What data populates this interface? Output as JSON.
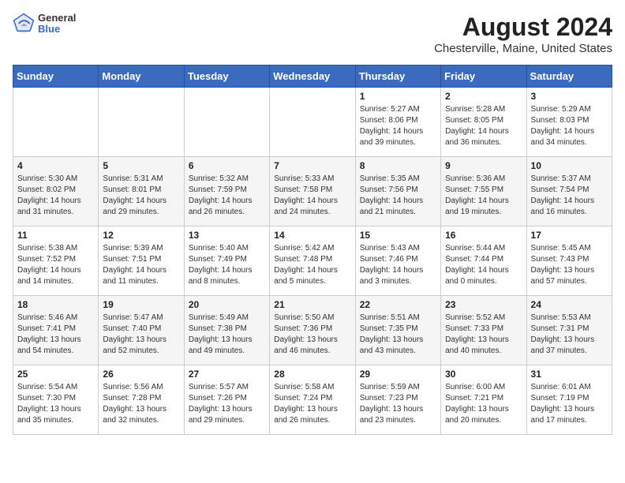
{
  "header": {
    "logo": {
      "general": "General",
      "blue": "Blue"
    },
    "title": "August 2024",
    "subtitle": "Chesterville, Maine, United States"
  },
  "days_of_week": [
    "Sunday",
    "Monday",
    "Tuesday",
    "Wednesday",
    "Thursday",
    "Friday",
    "Saturday"
  ],
  "weeks": [
    [
      {
        "day": "",
        "content": ""
      },
      {
        "day": "",
        "content": ""
      },
      {
        "day": "",
        "content": ""
      },
      {
        "day": "",
        "content": ""
      },
      {
        "day": "1",
        "content": "Sunrise: 5:27 AM\nSunset: 8:06 PM\nDaylight: 14 hours\nand 39 minutes."
      },
      {
        "day": "2",
        "content": "Sunrise: 5:28 AM\nSunset: 8:05 PM\nDaylight: 14 hours\nand 36 minutes."
      },
      {
        "day": "3",
        "content": "Sunrise: 5:29 AM\nSunset: 8:03 PM\nDaylight: 14 hours\nand 34 minutes."
      }
    ],
    [
      {
        "day": "4",
        "content": "Sunrise: 5:30 AM\nSunset: 8:02 PM\nDaylight: 14 hours\nand 31 minutes."
      },
      {
        "day": "5",
        "content": "Sunrise: 5:31 AM\nSunset: 8:01 PM\nDaylight: 14 hours\nand 29 minutes."
      },
      {
        "day": "6",
        "content": "Sunrise: 5:32 AM\nSunset: 7:59 PM\nDaylight: 14 hours\nand 26 minutes."
      },
      {
        "day": "7",
        "content": "Sunrise: 5:33 AM\nSunset: 7:58 PM\nDaylight: 14 hours\nand 24 minutes."
      },
      {
        "day": "8",
        "content": "Sunrise: 5:35 AM\nSunset: 7:56 PM\nDaylight: 14 hours\nand 21 minutes."
      },
      {
        "day": "9",
        "content": "Sunrise: 5:36 AM\nSunset: 7:55 PM\nDaylight: 14 hours\nand 19 minutes."
      },
      {
        "day": "10",
        "content": "Sunrise: 5:37 AM\nSunset: 7:54 PM\nDaylight: 14 hours\nand 16 minutes."
      }
    ],
    [
      {
        "day": "11",
        "content": "Sunrise: 5:38 AM\nSunset: 7:52 PM\nDaylight: 14 hours\nand 14 minutes."
      },
      {
        "day": "12",
        "content": "Sunrise: 5:39 AM\nSunset: 7:51 PM\nDaylight: 14 hours\nand 11 minutes."
      },
      {
        "day": "13",
        "content": "Sunrise: 5:40 AM\nSunset: 7:49 PM\nDaylight: 14 hours\nand 8 minutes."
      },
      {
        "day": "14",
        "content": "Sunrise: 5:42 AM\nSunset: 7:48 PM\nDaylight: 14 hours\nand 5 minutes."
      },
      {
        "day": "15",
        "content": "Sunrise: 5:43 AM\nSunset: 7:46 PM\nDaylight: 14 hours\nand 3 minutes."
      },
      {
        "day": "16",
        "content": "Sunrise: 5:44 AM\nSunset: 7:44 PM\nDaylight: 14 hours\nand 0 minutes."
      },
      {
        "day": "17",
        "content": "Sunrise: 5:45 AM\nSunset: 7:43 PM\nDaylight: 13 hours\nand 57 minutes."
      }
    ],
    [
      {
        "day": "18",
        "content": "Sunrise: 5:46 AM\nSunset: 7:41 PM\nDaylight: 13 hours\nand 54 minutes."
      },
      {
        "day": "19",
        "content": "Sunrise: 5:47 AM\nSunset: 7:40 PM\nDaylight: 13 hours\nand 52 minutes."
      },
      {
        "day": "20",
        "content": "Sunrise: 5:49 AM\nSunset: 7:38 PM\nDaylight: 13 hours\nand 49 minutes."
      },
      {
        "day": "21",
        "content": "Sunrise: 5:50 AM\nSunset: 7:36 PM\nDaylight: 13 hours\nand 46 minutes."
      },
      {
        "day": "22",
        "content": "Sunrise: 5:51 AM\nSunset: 7:35 PM\nDaylight: 13 hours\nand 43 minutes."
      },
      {
        "day": "23",
        "content": "Sunrise: 5:52 AM\nSunset: 7:33 PM\nDaylight: 13 hours\nand 40 minutes."
      },
      {
        "day": "24",
        "content": "Sunrise: 5:53 AM\nSunset: 7:31 PM\nDaylight: 13 hours\nand 37 minutes."
      }
    ],
    [
      {
        "day": "25",
        "content": "Sunrise: 5:54 AM\nSunset: 7:30 PM\nDaylight: 13 hours\nand 35 minutes."
      },
      {
        "day": "26",
        "content": "Sunrise: 5:56 AM\nSunset: 7:28 PM\nDaylight: 13 hours\nand 32 minutes."
      },
      {
        "day": "27",
        "content": "Sunrise: 5:57 AM\nSunset: 7:26 PM\nDaylight: 13 hours\nand 29 minutes."
      },
      {
        "day": "28",
        "content": "Sunrise: 5:58 AM\nSunset: 7:24 PM\nDaylight: 13 hours\nand 26 minutes."
      },
      {
        "day": "29",
        "content": "Sunrise: 5:59 AM\nSunset: 7:23 PM\nDaylight: 13 hours\nand 23 minutes."
      },
      {
        "day": "30",
        "content": "Sunrise: 6:00 AM\nSunset: 7:21 PM\nDaylight: 13 hours\nand 20 minutes."
      },
      {
        "day": "31",
        "content": "Sunrise: 6:01 AM\nSunset: 7:19 PM\nDaylight: 13 hours\nand 17 minutes."
      }
    ]
  ]
}
